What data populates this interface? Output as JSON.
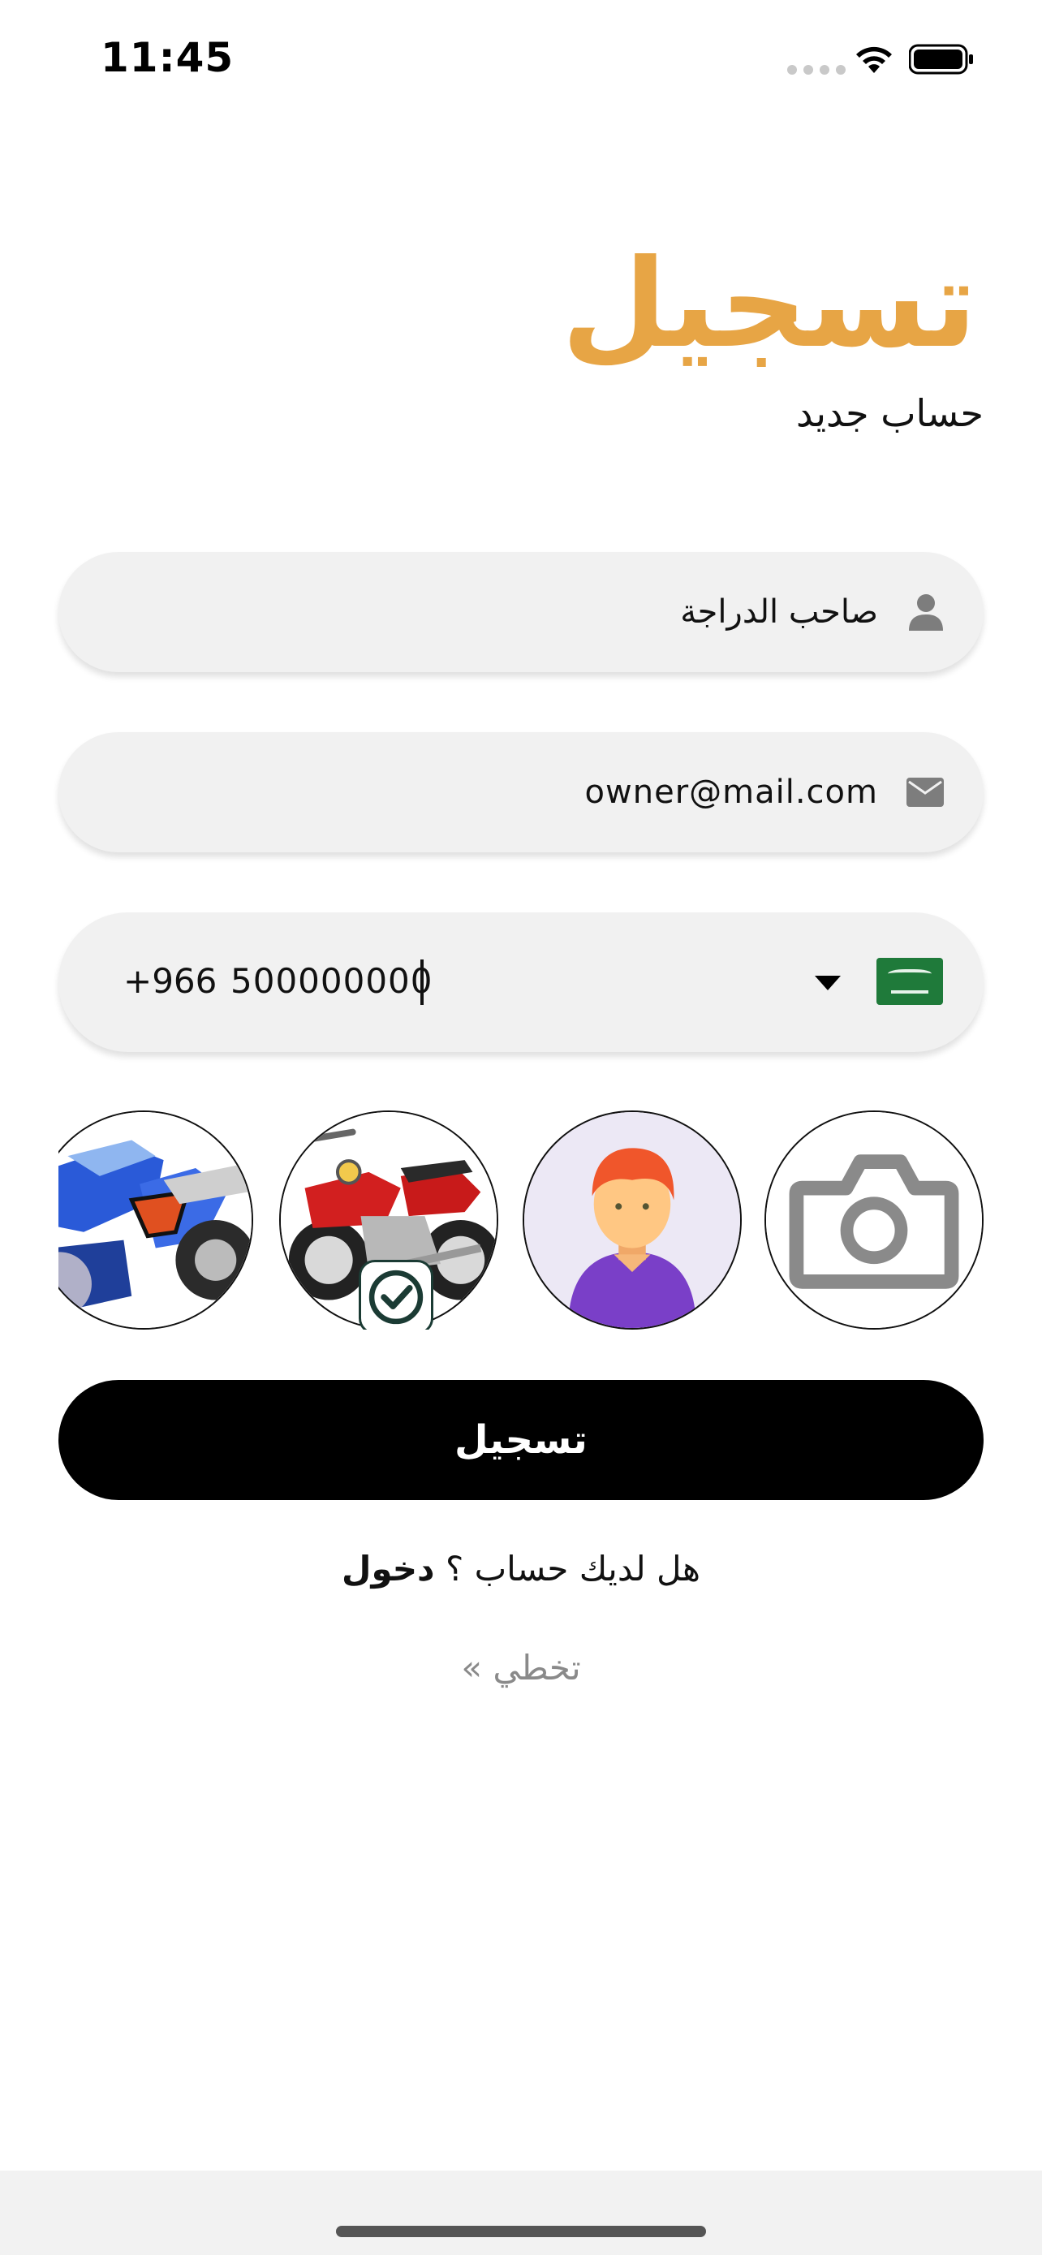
{
  "status_bar": {
    "time": "11:45"
  },
  "header": {
    "title": "تسجيل",
    "subtitle": "حساب جديد"
  },
  "form": {
    "name_value": "صاحب الدراجة",
    "email_value": "owner@mail.com",
    "phone": {
      "country_code": "+966",
      "number": "500000000",
      "country_flag": "saudi-arabia-flag"
    }
  },
  "avatars": [
    {
      "name": "camera-upload",
      "selected": false
    },
    {
      "name": "person-avatar",
      "selected": false
    },
    {
      "name": "red-motorcycle",
      "selected": true
    },
    {
      "name": "blue-motorcycle",
      "selected": false
    }
  ],
  "actions": {
    "submit_label": "تسجيل",
    "have_account_text": "هل لديك حساب ؟",
    "login_link": "دخول",
    "skip_label": "تخطي »"
  },
  "colors": {
    "accent": "#E7A545",
    "button": "#000000",
    "field_bg": "#f1f1f1"
  }
}
